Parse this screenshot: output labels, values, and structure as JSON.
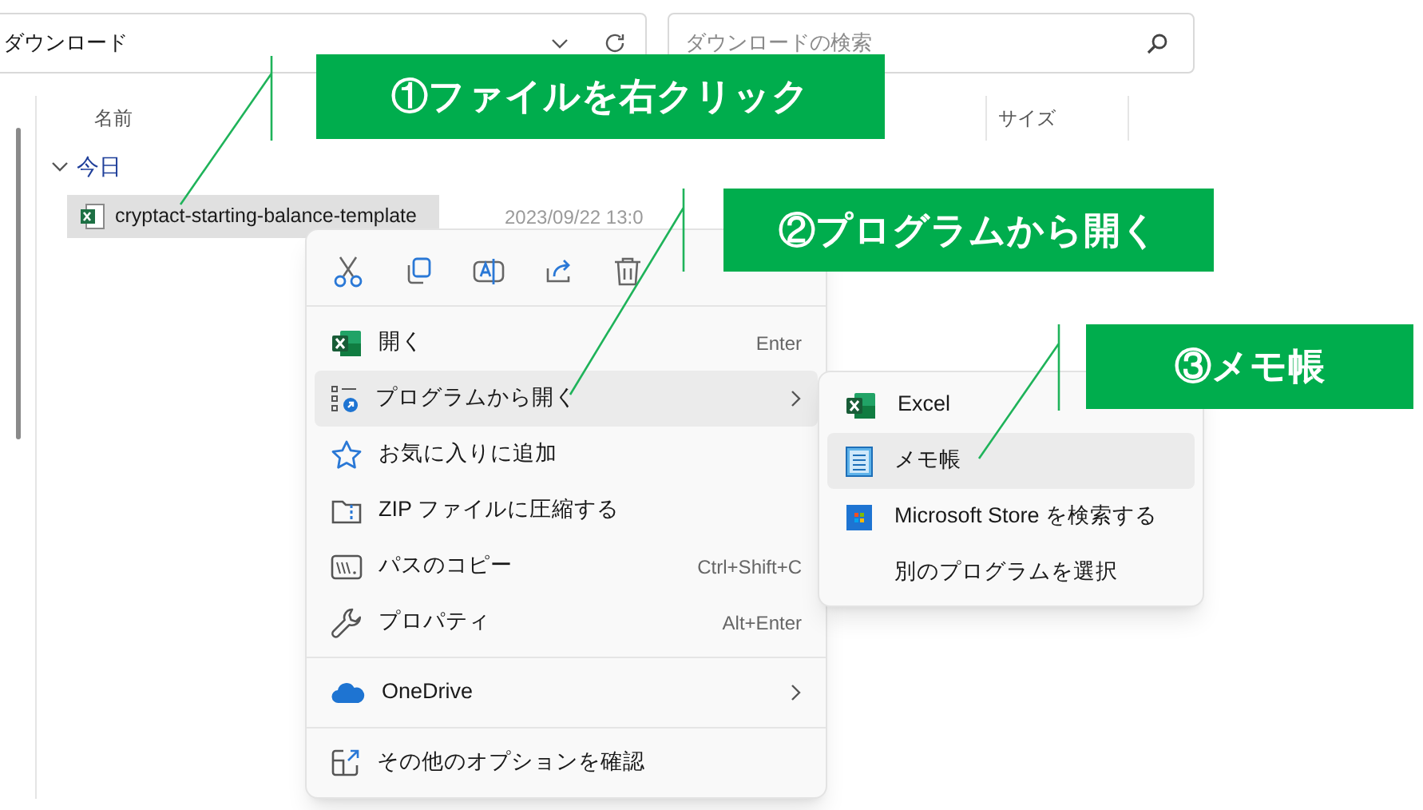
{
  "address_bar": {
    "path": "ダウンロード"
  },
  "search": {
    "placeholder": "ダウンロードの検索"
  },
  "columns": [
    {
      "label": "名前"
    },
    {
      "label": "サイズ"
    }
  ],
  "group": {
    "label": "今日",
    "expanded": true
  },
  "file": {
    "name": "cryptact-starting-balance-template",
    "date": "2023/09/22 13:0",
    "selected": true
  },
  "context_menu": {
    "items": [
      {
        "kind": "excel",
        "label": "開く",
        "shortcut": "Enter",
        "submenu": false,
        "selected": false
      },
      {
        "kind": "open-with",
        "label": "プログラムから開く",
        "submenu": true,
        "selected": true
      },
      {
        "kind": "star",
        "label": "お気に入りに追加",
        "submenu": false,
        "selected": false
      },
      {
        "kind": "zip",
        "label": "ZIP ファイルに圧縮する",
        "submenu": false,
        "selected": false
      },
      {
        "kind": "path",
        "label": "パスのコピー",
        "shortcut": "Ctrl+Shift+C",
        "submenu": false,
        "selected": false
      },
      {
        "kind": "wrench",
        "label": "プロパティ",
        "shortcut": "Alt+Enter",
        "submenu": false,
        "selected": false
      },
      {
        "kind": "separator"
      },
      {
        "kind": "cloud",
        "label": "OneDrive",
        "submenu": true,
        "selected": false
      },
      {
        "kind": "separator"
      },
      {
        "kind": "more",
        "label": "その他のオプションを確認",
        "submenu": false,
        "selected": false
      }
    ]
  },
  "submenu": {
    "items": [
      {
        "kind": "excel",
        "label": "Excel",
        "selected": false
      },
      {
        "kind": "notepad",
        "label": "メモ帳",
        "selected": true
      },
      {
        "kind": "store",
        "label": "Microsoft Store を検索する",
        "selected": false
      },
      {
        "kind": "none",
        "label": "別のプログラムを選択",
        "selected": false
      }
    ]
  },
  "callouts": [
    {
      "label": "①ファイルを右クリック"
    },
    {
      "label": "②プログラムから開く"
    },
    {
      "label": "③メモ帳"
    }
  ]
}
